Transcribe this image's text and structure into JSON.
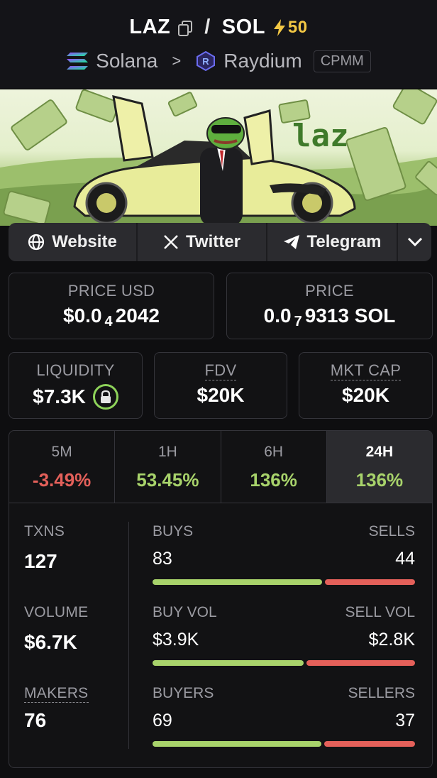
{
  "header": {
    "base_token": "LAZ",
    "separator": "/",
    "quote_token": "SOL",
    "boost_count": "50",
    "chain": "Solana",
    "dex": "Raydium",
    "pool_type": "CPMM"
  },
  "banner": {
    "text": "laz"
  },
  "social": {
    "website": "Website",
    "twitter": "Twitter",
    "telegram": "Telegram"
  },
  "prices": {
    "usd_label": "PRICE USD",
    "usd_prefix": "$0.0",
    "usd_zeros": "4",
    "usd_digits": "2042",
    "native_label": "PRICE",
    "native_prefix": "0.0",
    "native_zeros": "7",
    "native_digits": "9313 SOL"
  },
  "metrics": {
    "liquidity_label": "LIQUIDITY",
    "liquidity_value": "$7.3K",
    "fdv_label": "FDV",
    "fdv_value": "$20K",
    "mktcap_label": "MKT CAP",
    "mktcap_value": "$20K"
  },
  "timeframes": [
    {
      "label": "5M",
      "value": "-3.49%",
      "trend": "negative"
    },
    {
      "label": "1H",
      "value": "53.45%",
      "trend": "positive"
    },
    {
      "label": "6H",
      "value": "136%",
      "trend": "positive"
    },
    {
      "label": "24H",
      "value": "136%",
      "trend": "positive",
      "selected": true
    }
  ],
  "stats": {
    "txns_label": "TXNS",
    "txns_value": "127",
    "volume_label": "VOLUME",
    "volume_value": "$6.7K",
    "makers_label": "MAKERS",
    "makers_value": "76",
    "buys_label": "BUYS",
    "buys_value": "83",
    "sells_label": "SELLS",
    "sells_value": "44",
    "buys_fraction": 0.654,
    "buyvol_label": "BUY VOL",
    "buyvol_value": "$3.9K",
    "sellvol_label": "SELL VOL",
    "sellvol_value": "$2.8K",
    "buyvol_fraction": 0.582,
    "buyers_label": "BUYERS",
    "buyers_value": "69",
    "sellers_label": "SELLERS",
    "sellers_value": "37",
    "buyers_fraction": 0.651
  },
  "colors": {
    "positive": "#a8d36b",
    "negative": "#e4605a",
    "boost": "#f2c744",
    "background": "#0e0e10"
  }
}
